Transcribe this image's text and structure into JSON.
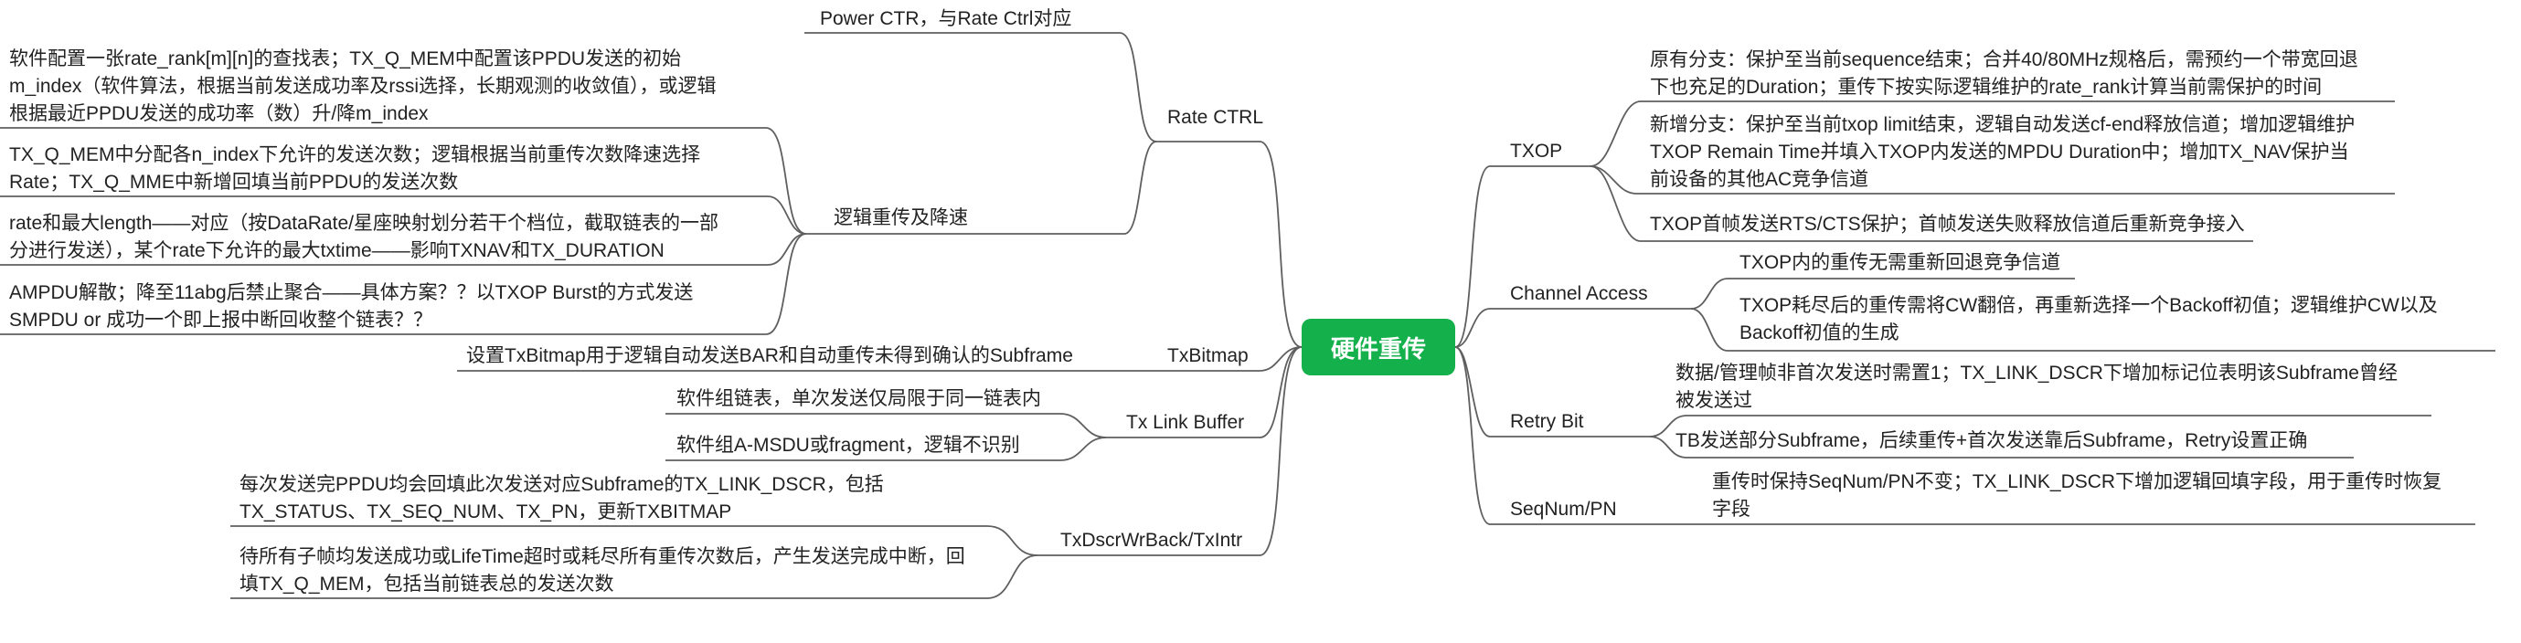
{
  "root": {
    "label": "硬件重传"
  },
  "left": {
    "power_ctr": "Power CTR，与Rate Ctrl对应",
    "rate_ctrl": {
      "label": "Rate CTRL",
      "sub": {
        "label": "逻辑重传及降速",
        "items": [
          [
            "软件配置一张rate_rank[m][n]的查找表；TX_Q_MEM中配置该PPDU发送的初始",
            "m_index（软件算法，根据当前发送成功率及rssi选择，长期观测的收敛值），或逻辑",
            "根据最近PPDU发送的成功率（数）升/降m_index"
          ],
          [
            "TX_Q_MEM中分配各n_index下允许的发送次数；逻辑根据当前重传次数降速选择",
            "Rate；TX_Q_MME中新增回填当前PPDU的发送次数"
          ],
          [
            "rate和最大length——对应（按DataRate/星座映射划分若干个档位，截取链表的一部",
            "分进行发送），某个rate下允许的最大txtime——影响TXNAV和TX_DURATION"
          ],
          [
            "AMPDU解散；降至11abg后禁止聚合——具体方案？？以TXOP Burst的方式发送",
            "SMPDU or 成功一个即上报中断回收整个链表？？"
          ]
        ]
      }
    },
    "txbitmap": {
      "label": "TxBitmap",
      "items": [
        [
          "设置TxBitmap用于逻辑自动发送BAR和自动重传未得到确认的Subframe"
        ]
      ]
    },
    "tx_link_buffer": {
      "label": "Tx Link Buffer",
      "items": [
        [
          "软件组链表，单次发送仅局限于同一链表内"
        ],
        [
          "软件组A-MSDU或fragment，逻辑不识别"
        ]
      ]
    },
    "txdscr": {
      "label": "TxDscrWrBack/TxIntr",
      "items": [
        [
          "每次发送完PPDU均会回填此次发送对应Subframe的TX_LINK_DSCR，包括",
          "TX_STATUS、TX_SEQ_NUM、TX_PN，更新TXBITMAP"
        ],
        [
          "待所有子帧均发送成功或LifeTime超时或耗尽所有重传次数后，产生发送完成中断，回",
          "填TX_Q_MEM，包括当前链表总的发送次数"
        ]
      ]
    }
  },
  "right": {
    "txop": {
      "label": "TXOP",
      "items": [
        [
          "原有分支：保护至当前sequence结束；合并40/80MHz规格后，需预约一个带宽回退",
          "下也充足的Duration；重传下按实际逻辑维护的rate_rank计算当前需保护的时间"
        ],
        [
          "新增分支：保护至当前txop limit结束，逻辑自动发送cf-end释放信道；增加逻辑维护",
          "TXOP Remain Time并填入TXOP内发送的MPDU Duration中；增加TX_NAV保护当",
          "前设备的其他AC竞争信道"
        ],
        [
          "TXOP首帧发送RTS/CTS保护；首帧发送失败释放信道后重新竞争接入"
        ]
      ]
    },
    "channel_access": {
      "label": "Channel Access",
      "items": [
        [
          "TXOP内的重传无需重新回退竞争信道"
        ],
        [
          "TXOP耗尽后的重传需将CW翻倍，再重新选择一个Backoff初值；逻辑维护CW以及",
          "Backoff初值的生成"
        ]
      ]
    },
    "retry_bit": {
      "label": "Retry Bit",
      "items": [
        [
          "数据/管理帧非首次发送时需置1；TX_LINK_DSCR下增加标记位表明该Subframe曾经",
          "被发送过"
        ],
        [
          "TB发送部分Subframe，后续重传+首次发送靠后Subframe，Retry设置正确"
        ]
      ]
    },
    "seqnum": {
      "label": "SeqNum/PN",
      "items": [
        [
          "重传时保持SeqNum/PN不变；TX_LINK_DSCR下增加逻辑回填字段，用于重传时恢复",
          "字段"
        ]
      ]
    }
  }
}
